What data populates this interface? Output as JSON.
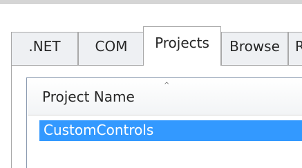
{
  "tabs": [
    {
      "label": ".NET"
    },
    {
      "label": "COM"
    },
    {
      "label": "Projects",
      "active": true
    },
    {
      "label": "Browse"
    },
    {
      "label": "R"
    }
  ],
  "list": {
    "sort_arrow": "^",
    "columns": [
      {
        "label": "Project Name"
      }
    ],
    "rows": [
      {
        "name": "CustomControls",
        "selected": true
      }
    ]
  },
  "colors": {
    "selection": "#3399ff",
    "tab_inactive": "#eef0f3",
    "border": "#a8a8a8"
  }
}
